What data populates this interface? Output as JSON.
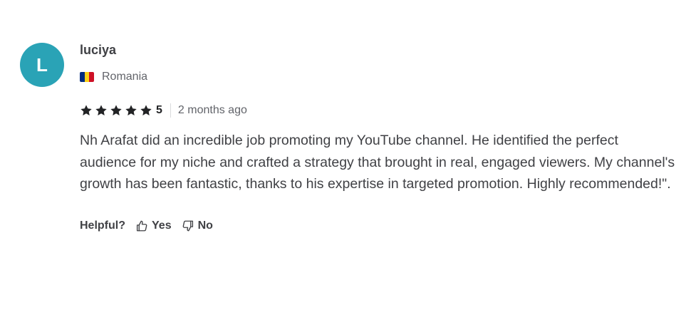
{
  "review": {
    "avatar_letter": "L",
    "avatar_color": "#2aa3b6",
    "username": "luciya",
    "country": "Romania",
    "flag_colors": [
      "#002b7f",
      "#fcd116",
      "#ce1126"
    ],
    "rating": {
      "stars": 5,
      "max": 5,
      "value_label": "5",
      "star_icon": "star-icon",
      "star_color": "#222325"
    },
    "time_ago": "2 months ago",
    "text": "Nh Arafat did an incredible job promoting my YouTube channel. He identified the perfect audience for my niche and crafted a strategy that brought in real, engaged viewers. My channel's growth has been fantastic, thanks to his expertise in targeted promotion. Highly recommended!\".",
    "helpful": {
      "label": "Helpful?",
      "yes_label": "Yes",
      "no_label": "No",
      "yes_icon": "thumbs-up-icon",
      "no_icon": "thumbs-down-icon"
    }
  }
}
